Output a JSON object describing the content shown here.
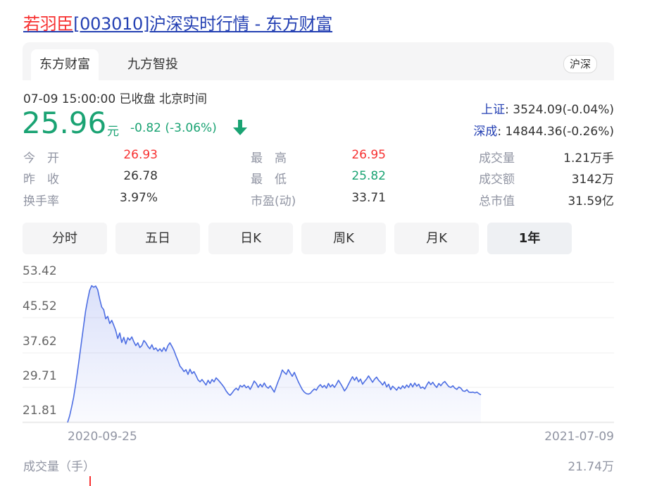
{
  "title": {
    "name": "若羽臣",
    "rest": "[003010]沪深实时行情 - 东方财富"
  },
  "tabs": [
    {
      "label": "东方财富"
    },
    {
      "label": "九方智投"
    }
  ],
  "region_badge": "沪深",
  "quote": {
    "time": "07-09 15:00:00  已收盘  北京时间",
    "price": "25.96",
    "unit": "元",
    "change": "-0.82 (-3.06%)"
  },
  "indices": [
    {
      "name": "上证",
      "value": ": 3524.09(-0.04%)"
    },
    {
      "name": "深成",
      "value": ": 14844.36(-0.26%)"
    }
  ],
  "stats": [
    {
      "label": "今　开",
      "value": "26.93",
      "color": "#f73131"
    },
    {
      "label": "最　高",
      "value": "26.95",
      "color": "#f73131"
    },
    {
      "label": "成交量",
      "value": "1.21万手",
      "color": "#333333"
    },
    {
      "label": "昨　收",
      "value": "26.78",
      "color": "#333333"
    },
    {
      "label": "最　低",
      "value": "25.82",
      "color": "#1aa373"
    },
    {
      "label": "成交额",
      "value": "3142万",
      "color": "#333333"
    },
    {
      "label": "换手率",
      "value": "3.97%",
      "color": "#333333"
    },
    {
      "label": "市盈(动)",
      "value": "33.71",
      "color": "#333333"
    },
    {
      "label": "总市值",
      "value": "31.59亿",
      "color": "#333333"
    }
  ],
  "periods": [
    {
      "label": "分时"
    },
    {
      "label": "五日"
    },
    {
      "label": "日K"
    },
    {
      "label": "周K"
    },
    {
      "label": "月K"
    },
    {
      "label": "1年",
      "active": true
    }
  ],
  "chart_data": {
    "type": "area",
    "y_ticks": [
      "53.42",
      "45.52",
      "37.62",
      "29.71",
      "21.81"
    ],
    "ylim": [
      17.86,
      53.42
    ],
    "x_start_label": "2020-09-25",
    "x_end_label": "2021-07-09",
    "series": [
      {
        "values": [
          17.9,
          19.5,
          21.8,
          24.2,
          27.5,
          31.0,
          34.8,
          38.6,
          42.5,
          46.2,
          49.0,
          51.4,
          52.6,
          52.2,
          52.5,
          51.6,
          49.2,
          47.2,
          46.5,
          44.2,
          44.8,
          43.0,
          43.8,
          42.6,
          41.2,
          39.2,
          40.6,
          38.2,
          39.5,
          37.8,
          39.4,
          38.8,
          39.6,
          38.4,
          37.4,
          38.1,
          36.9,
          37.4,
          38.7,
          38.1,
          37.2,
          36.6,
          37.6,
          36.4,
          36.8,
          36.0,
          36.6,
          35.9,
          36.9,
          36.0,
          37.4,
          38.1,
          37.2,
          36.2,
          34.8,
          33.6,
          32.2,
          31.6,
          30.8,
          31.3,
          30.1,
          31.4,
          30.3,
          30.8,
          29.8,
          28.7,
          28.2,
          28.8,
          28.1,
          27.4,
          28.6,
          27.8,
          28.8,
          28.2,
          29.2,
          28.7,
          28.1,
          27.5,
          26.8,
          25.9,
          25.2,
          24.8,
          25.4,
          26.1,
          26.6,
          26.1,
          27.3,
          26.9,
          27.4,
          26.7,
          27.1,
          26.3,
          27.3,
          28.4,
          27.8,
          26.8,
          27.6,
          26.9,
          27.9,
          27.0,
          26.6,
          27.2,
          26.4,
          25.6,
          27.0,
          28.4,
          29.6,
          31.2,
          30.6,
          30.1,
          31.3,
          30.4,
          29.6,
          30.6,
          29.4,
          28.2,
          27.2,
          26.2,
          25.6,
          25.2,
          25.1,
          25.3,
          25.9,
          26.4,
          26.1,
          27.0,
          27.5,
          26.8,
          27.3,
          26.6,
          27.8,
          26.9,
          27.5,
          26.8,
          27.6,
          28.6,
          27.8,
          26.9,
          25.9,
          26.6,
          27.6,
          28.6,
          29.5,
          28.6,
          29.4,
          28.2,
          28.9,
          27.6,
          28.3,
          28.9,
          29.7,
          28.9,
          28.1,
          28.9,
          29.4,
          28.6,
          28.1,
          27.4,
          28.2,
          26.9,
          27.6,
          26.2,
          27.1,
          26.6,
          26.1,
          26.9,
          26.4,
          27.2,
          26.6,
          27.4,
          26.8,
          27.8,
          26.9,
          27.9,
          27.1,
          27.6,
          26.6,
          26.9,
          26.4,
          27.4,
          28.2,
          27.5,
          28.1,
          27.3,
          26.8,
          27.8,
          27.2,
          27.9,
          28.3,
          27.6,
          27.0,
          26.8,
          27.2,
          26.6,
          26.3,
          26.9,
          26.6,
          25.9,
          25.8,
          26.2,
          25.6,
          25.5,
          25.6,
          25.4,
          25.6,
          25.2,
          24.9
        ]
      }
    ]
  }
}
